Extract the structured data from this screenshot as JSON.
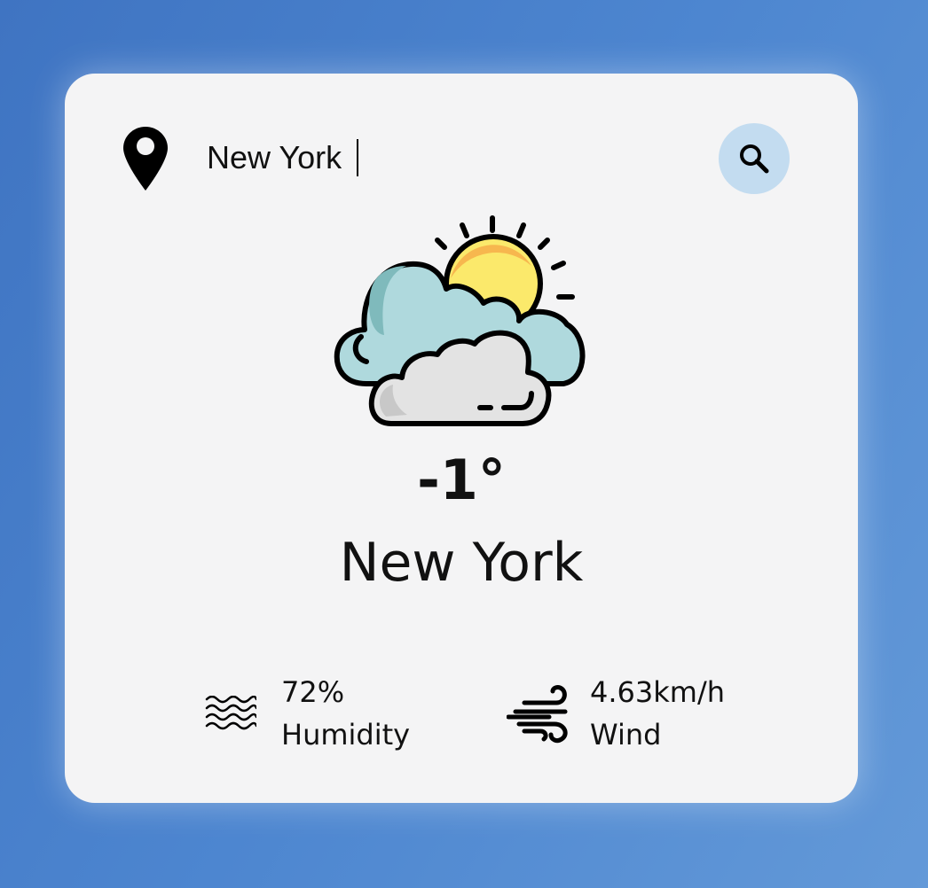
{
  "search": {
    "value": "New York",
    "icon": "location-pin-icon",
    "button_icon": "search-icon"
  },
  "weather": {
    "icon": "partly-cloudy-icon",
    "temperature": "-1°",
    "city": "New York"
  },
  "stats": {
    "humidity": {
      "value": "72%",
      "label": "Humidity",
      "icon": "humidity-waves-icon"
    },
    "wind": {
      "value": "4.63km/h",
      "label": "Wind",
      "icon": "wind-icon"
    }
  },
  "colors": {
    "background": "#4a80cb",
    "card": "#f4f4f5",
    "search_button": "#c3dcf0",
    "sun": "#fbe96b",
    "cloud_back": "#afd9dd",
    "cloud_front": "#e3e3e3"
  }
}
